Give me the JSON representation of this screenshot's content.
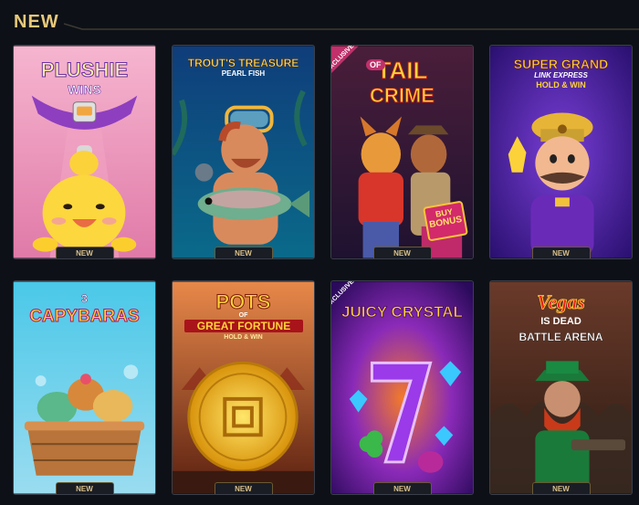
{
  "section": {
    "title": "NEW"
  },
  "games": [
    {
      "title_line1": "PLUSHIE",
      "title_line2": "WINS",
      "badge": "NEW"
    },
    {
      "title_line1": "TROUT'S TREASURE",
      "title_line2": "PEARL FISH",
      "badge": "NEW"
    },
    {
      "title_line1": "TAIL",
      "title_of": "OF",
      "title_line2": "CRIME",
      "exclusive": "EXCLUSIVE",
      "bonus_line1": "BUY",
      "bonus_line2": "BONUS",
      "badge": "NEW"
    },
    {
      "title_line1": "SUPER GRAND",
      "title_line2": "LINK EXPRESS",
      "title_line3": "HOLD & WIN",
      "badge": "NEW"
    },
    {
      "title_num": "3",
      "title_line1": "CAPYBARAS",
      "badge": "NEW"
    },
    {
      "title_line1": "POTS",
      "title_of": "OF",
      "title_line2": "GREAT FORTUNE",
      "title_line3": "HOLD & WIN",
      "badge": "NEW"
    },
    {
      "title_line1": "JUICY CRYSTAL",
      "exclusive": "EXCLUSIVE",
      "badge": "NEW"
    },
    {
      "title_line1": "Vegas",
      "title_line2": "IS DEAD",
      "title_line3": "BATTLE ARENA",
      "badge": "NEW"
    }
  ],
  "colors": {
    "background": "#0d1117",
    "title": "#e8c97a",
    "badge_text": "#d9c08a",
    "badge_border": "#6a5a35"
  }
}
